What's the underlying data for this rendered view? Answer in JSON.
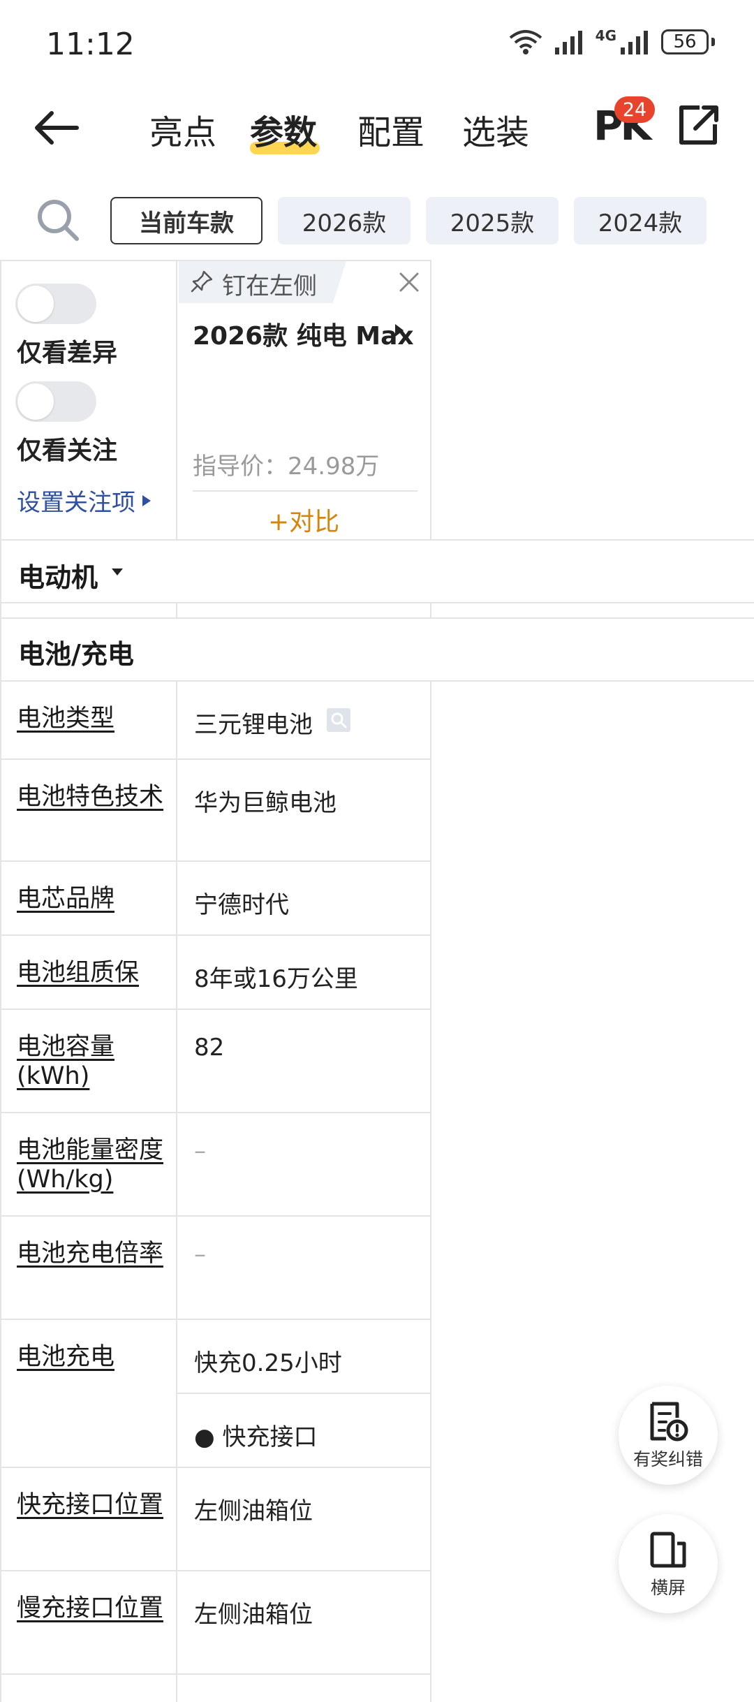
{
  "status": {
    "time": "11:12",
    "network": "4G",
    "battery": "56"
  },
  "nav": {
    "tabs": [
      {
        "label": "亮点"
      },
      {
        "label": "参数"
      },
      {
        "label": "配置"
      },
      {
        "label": "选装"
      }
    ],
    "active_tab": "参数",
    "pk_label": "PK",
    "pk_badge": "24"
  },
  "years": {
    "chips": [
      "当前车款",
      "2026款",
      "2025款",
      "2024款"
    ],
    "selected": "当前车款"
  },
  "filters": {
    "diff_only": "仅看差异",
    "follow_only": "仅看关注",
    "set_follow": "设置关注项"
  },
  "car": {
    "pin_label": "钉在左侧",
    "name": "2026款 纯电 Max",
    "guide_price": "指导价：24.98万",
    "compare_label": "+对比"
  },
  "sections": {
    "motor": "电动机",
    "battery": "电池/充电"
  },
  "params": [
    {
      "label": "电池类型",
      "value": "三元锂电池"
    },
    {
      "label": "电池特色技术",
      "value": "华为巨鲸电池"
    },
    {
      "label": "电芯品牌",
      "value": "宁德时代"
    },
    {
      "label": "电池组质保",
      "value": "8年或16万公里"
    },
    {
      "label": "电池容量(kWh)",
      "value": "82"
    },
    {
      "label": "电池能量密度(Wh/kg)",
      "value": "–"
    },
    {
      "label": "电池充电倍率",
      "value": "–"
    },
    {
      "label": "电池充电",
      "value": "快充0.25小时",
      "sub_value": "● 快充接口"
    },
    {
      "label": "快充接口位置",
      "value": "左侧油箱位"
    },
    {
      "label": "慢充接口位置",
      "value": "左侧油箱位"
    }
  ],
  "float_buttons": {
    "report": "有奖纠错",
    "landscape": "横屏"
  },
  "colors": {
    "accent_orange": "#d4850a",
    "badge_red": "#e8432d",
    "tab_highlight": "#ffcf33",
    "link_blue": "#2f4fa0"
  }
}
